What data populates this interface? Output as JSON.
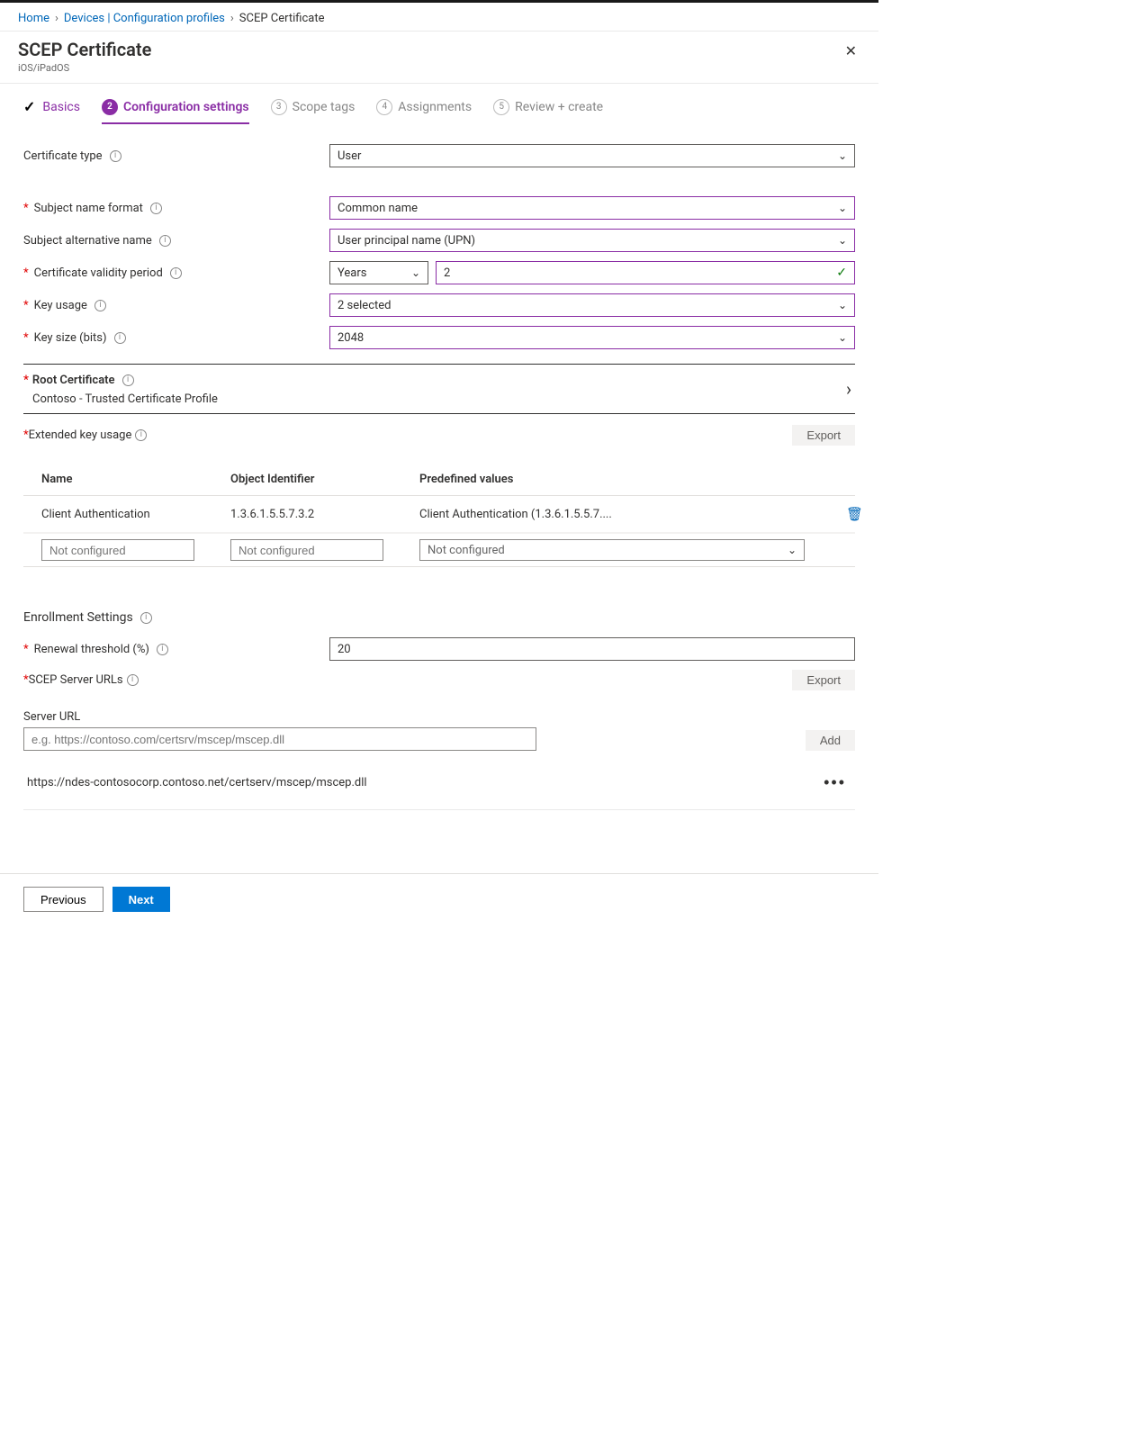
{
  "breadcrumb": {
    "home": "Home",
    "devices": "Devices | Configuration profiles",
    "current": "SCEP Certificate"
  },
  "header": {
    "title": "SCEP Certificate",
    "subtitle": "iOS/iPadOS"
  },
  "wizard": {
    "step1": "Basics",
    "step2": "Configuration settings",
    "step3": "Scope tags",
    "step4": "Assignments",
    "step5": "Review + create"
  },
  "form": {
    "cert_type_label": "Certificate type",
    "cert_type_value": "User",
    "subject_name_label": "Subject name format",
    "subject_name_value": "Common name",
    "san_label": "Subject alternative name",
    "san_value": "User principal name (UPN)",
    "validity_label": "Certificate validity period",
    "validity_unit": "Years",
    "validity_value": "2",
    "key_usage_label": "Key usage",
    "key_usage_value": "2 selected",
    "key_size_label": "Key size (bits)",
    "key_size_value": "2048"
  },
  "root_cert": {
    "label": "Root Certificate",
    "value": "Contoso - Trusted Certificate Profile"
  },
  "eku": {
    "label": "Extended key usage",
    "export_btn": "Export",
    "col_name": "Name",
    "col_oid": "Object Identifier",
    "col_predef": "Predefined values",
    "row_name": "Client Authentication",
    "row_oid": "1.3.6.1.5.5.7.3.2",
    "row_predef": "Client Authentication (1.3.6.1.5.5.7....",
    "placeholder_name": "Not configured",
    "placeholder_oid": "Not configured",
    "placeholder_predef": "Not configured"
  },
  "enrollment": {
    "title": "Enrollment Settings",
    "renewal_label": "Renewal threshold (%)",
    "renewal_value": "20",
    "scep_urls_label": "SCEP Server URLs",
    "export_btn": "Export",
    "add_btn": "Add",
    "server_url_label": "Server URL",
    "server_url_placeholder": "e.g. https://contoso.com/certsrv/mscep/mscep.dll",
    "url_value": "https://ndes-contosocorp.contoso.net/certserv/mscep/mscep.dll"
  },
  "footer": {
    "previous": "Previous",
    "next": "Next"
  }
}
